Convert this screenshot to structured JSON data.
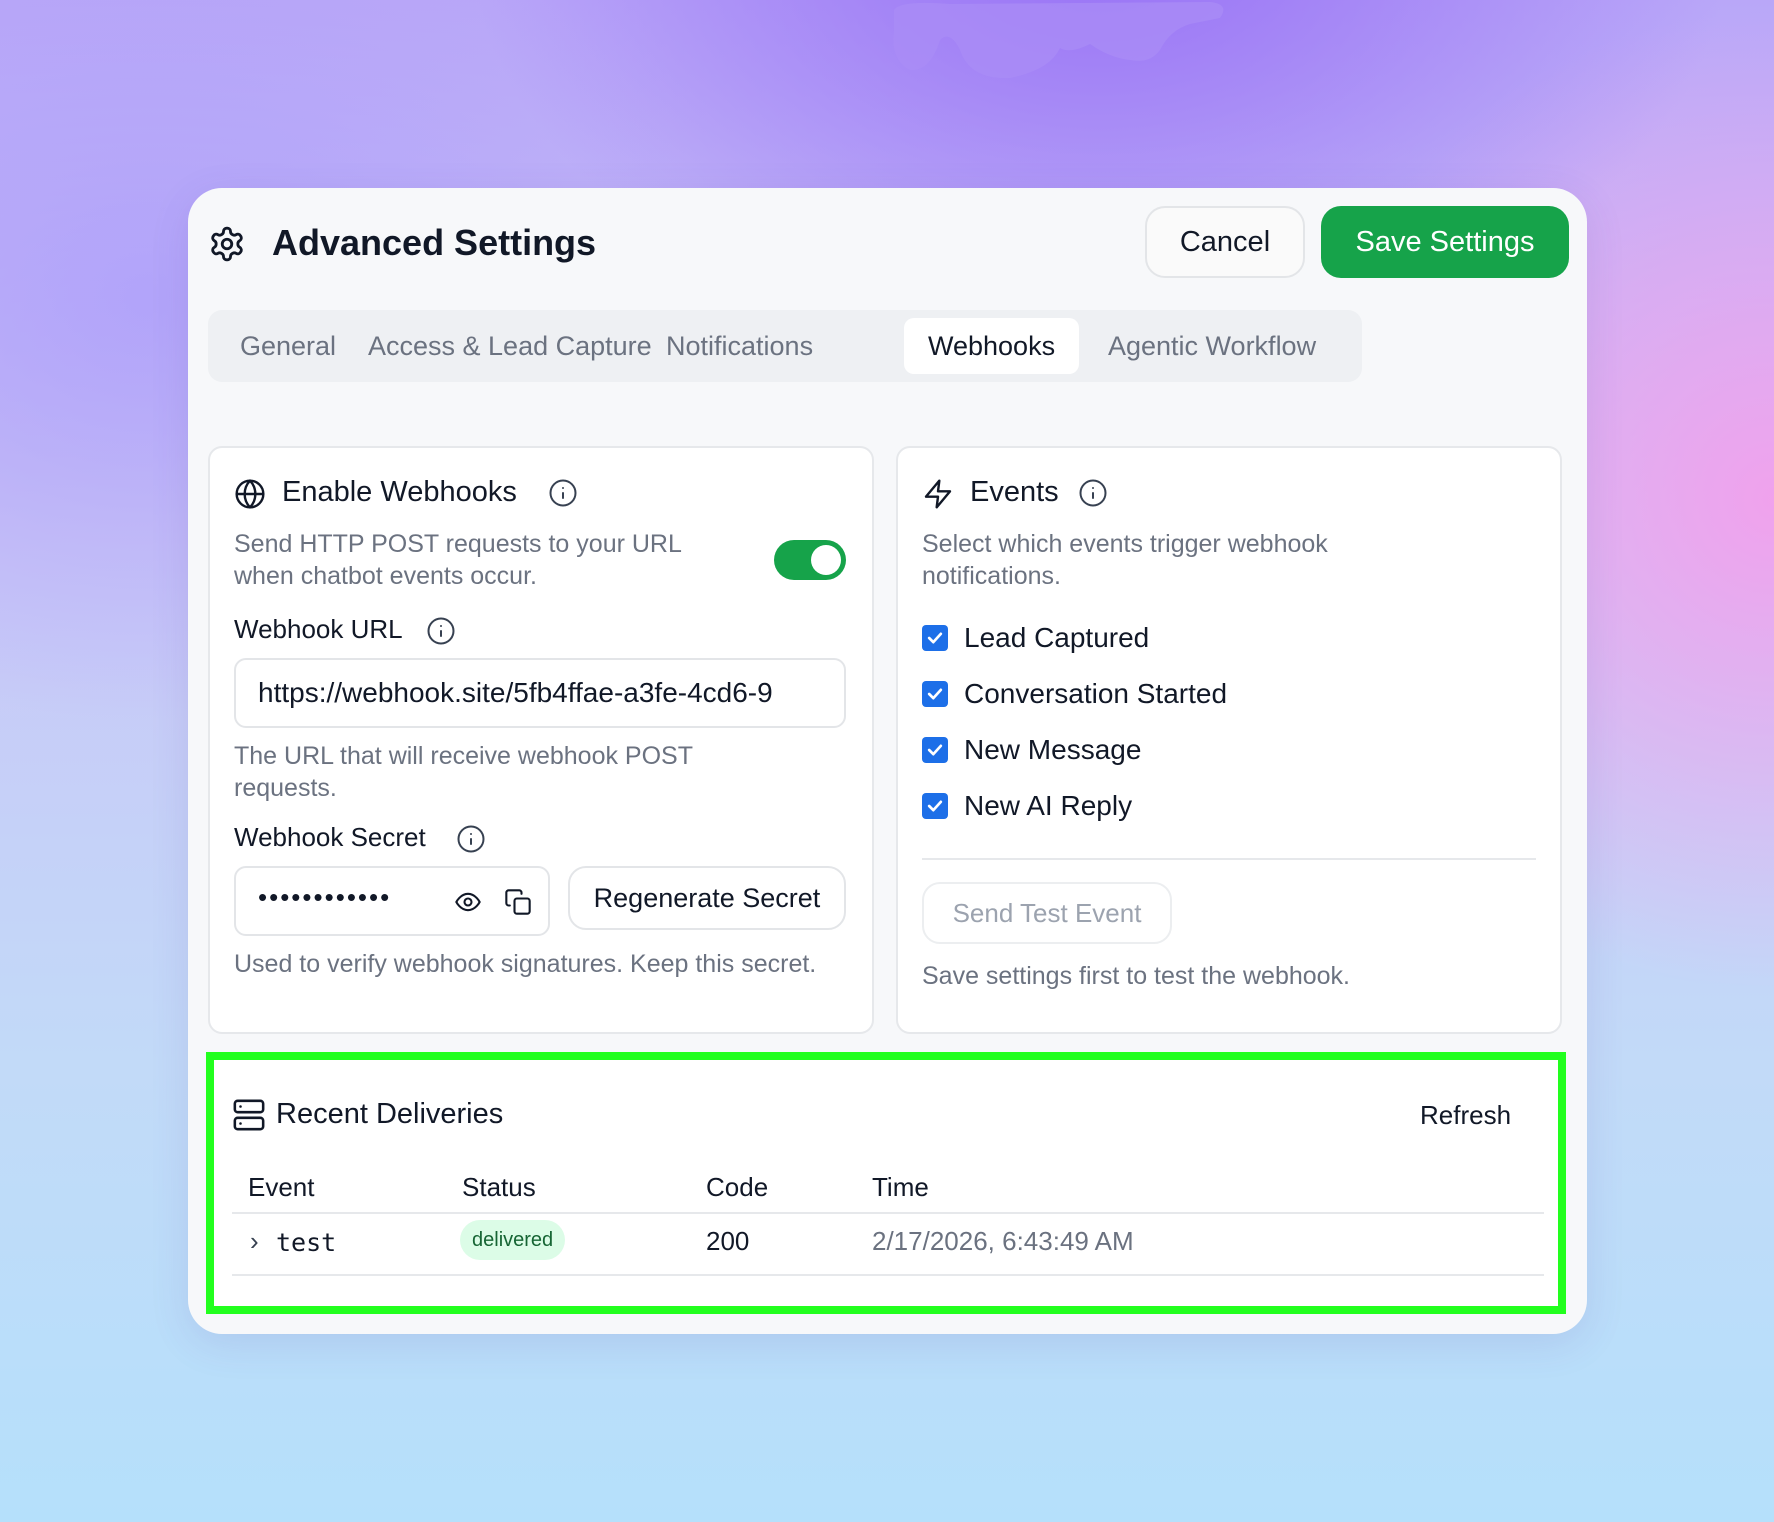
{
  "header": {
    "title": "Advanced Settings",
    "cancel_label": "Cancel",
    "save_label": "Save Settings"
  },
  "tabs": [
    {
      "label": "General"
    },
    {
      "label": "Access & Lead Capture"
    },
    {
      "label": "Notifications"
    },
    {
      "label": "Webhooks",
      "active": true
    },
    {
      "label": "Agentic Workflow"
    }
  ],
  "enable_card": {
    "title": "Enable Webhooks",
    "description": "Send HTTP POST requests to your URL when chatbot events occur.",
    "enabled": true,
    "url_label": "Webhook URL",
    "url_value": "https://webhook.site/5fb4ffae-a3fe-4cd6-9",
    "url_help": "The URL that will receive webhook POST requests.",
    "secret_label": "Webhook Secret",
    "secret_value": "••••••••••••",
    "regenerate_label": "Regenerate Secret",
    "secret_help": "Used to verify webhook signatures. Keep this secret."
  },
  "events_card": {
    "title": "Events",
    "description": "Select which events trigger webhook notifications.",
    "events": [
      {
        "label": "Lead Captured",
        "checked": true
      },
      {
        "label": "Conversation Started",
        "checked": true
      },
      {
        "label": "New Message",
        "checked": true
      },
      {
        "label": "New AI Reply",
        "checked": true
      }
    ],
    "test_label": "Send Test Event",
    "test_help": "Save settings first to test the webhook."
  },
  "deliveries": {
    "title": "Recent Deliveries",
    "refresh_label": "Refresh",
    "columns": [
      "Event",
      "Status",
      "Code",
      "Time"
    ],
    "rows": [
      {
        "expander": "›",
        "event": "test",
        "status": "delivered",
        "code": "200",
        "time": "2/17/2026, 6:43:49 AM"
      }
    ]
  },
  "colors": {
    "accent": "#16a34a",
    "checkbox": "#1d6fe8",
    "highlight": "#22ff1e"
  }
}
